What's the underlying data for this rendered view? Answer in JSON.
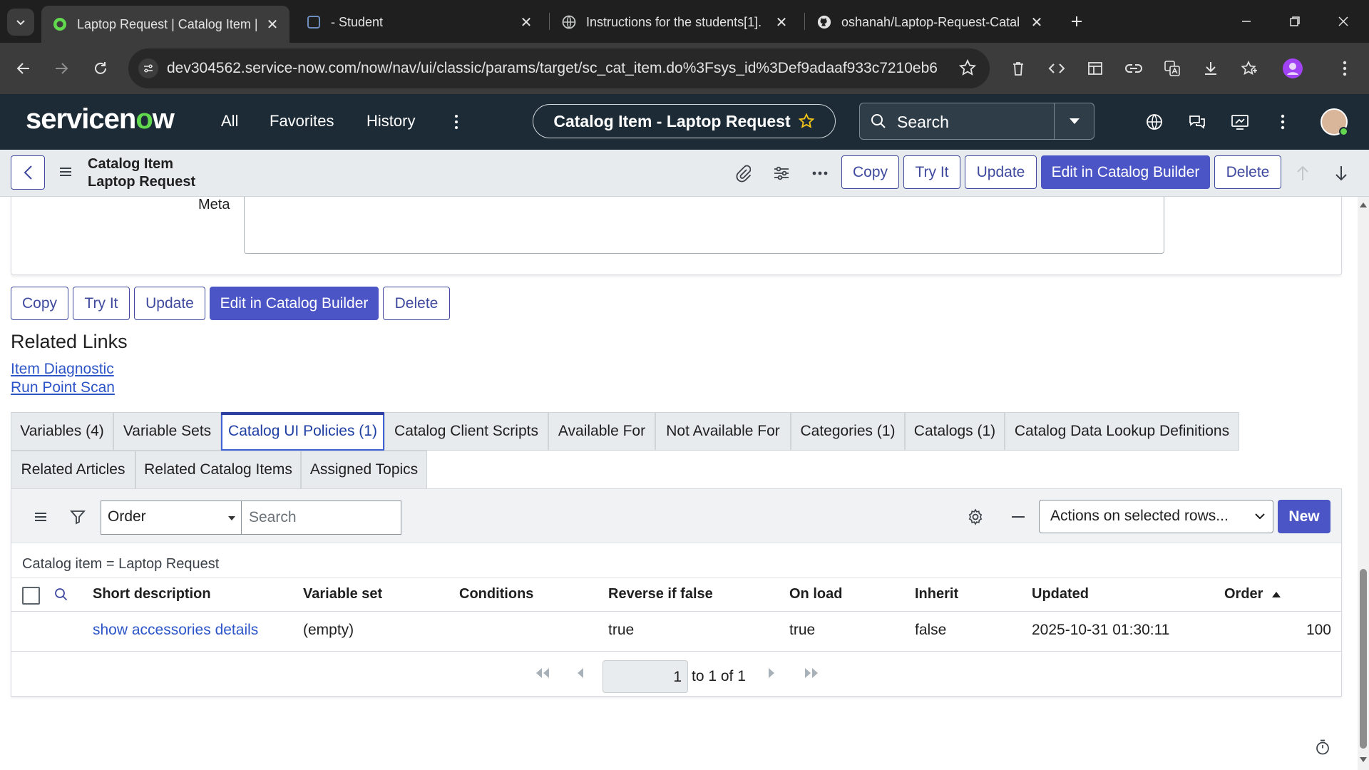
{
  "browser": {
    "tabs": [
      {
        "title": "Laptop Request | Catalog Item |",
        "active": true
      },
      {
        "title": "- Student",
        "active": false
      },
      {
        "title": "Instructions for the students[1].",
        "active": false
      },
      {
        "title": "oshanah/Laptop-Request-Catal",
        "active": false
      }
    ],
    "url": "dev304562.service-now.com/now/nav/ui/classic/params/target/sc_cat_item.do%3Fsys_id%3Def9adaaf933c7210eb6..."
  },
  "header": {
    "nav": {
      "all": "All",
      "favorites": "Favorites",
      "history": "History"
    },
    "context_title": "Catalog Item - Laptop Request",
    "search_label": "Search"
  },
  "form_header": {
    "line1": "Catalog Item",
    "line2": "Laptop Request",
    "buttons": {
      "copy": "Copy",
      "try_it": "Try It",
      "update": "Update",
      "edit_builder": "Edit in Catalog Builder",
      "delete": "Delete"
    }
  },
  "form": {
    "meta_label": "Meta",
    "buttons": {
      "copy": "Copy",
      "try_it": "Try It",
      "update": "Update",
      "edit_builder": "Edit in Catalog Builder",
      "delete": "Delete"
    }
  },
  "related_links": {
    "title": "Related Links",
    "links": [
      "Item Diagnostic",
      "Run Point Scan"
    ]
  },
  "related_tabs": {
    "row1": [
      "Variables (4)",
      "Variable Sets",
      "Catalog UI Policies (1)",
      "Catalog Client Scripts",
      "Available For",
      "Not Available For",
      "Categories (1)",
      "Catalogs (1)",
      "Catalog Data Lookup Definitions"
    ],
    "row2": [
      "Related Articles",
      "Related Catalog Items",
      "Assigned Topics"
    ],
    "active": "Catalog UI Policies (1)"
  },
  "list": {
    "order_select": "Order",
    "search_placeholder": "Search",
    "actions_select": "Actions on selected rows...",
    "new_button": "New",
    "filter": "Catalog item = Laptop Request",
    "columns": [
      "Short description",
      "Variable set",
      "Conditions",
      "Reverse if false",
      "On load",
      "Inherit",
      "Updated",
      "Order"
    ],
    "rows": [
      {
        "short_description": "show accessories details",
        "variable_set": "(empty)",
        "conditions": "",
        "reverse_if_false": "true",
        "on_load": "true",
        "inherit": "false",
        "updated": "2025-10-31 01:30:11",
        "order": "100"
      }
    ],
    "pager": {
      "page": "1",
      "text": "to 1 of 1"
    }
  },
  "colors": {
    "primary": "#4b55c6",
    "header_bg": "#1c2b36",
    "link": "#2d55c8"
  }
}
